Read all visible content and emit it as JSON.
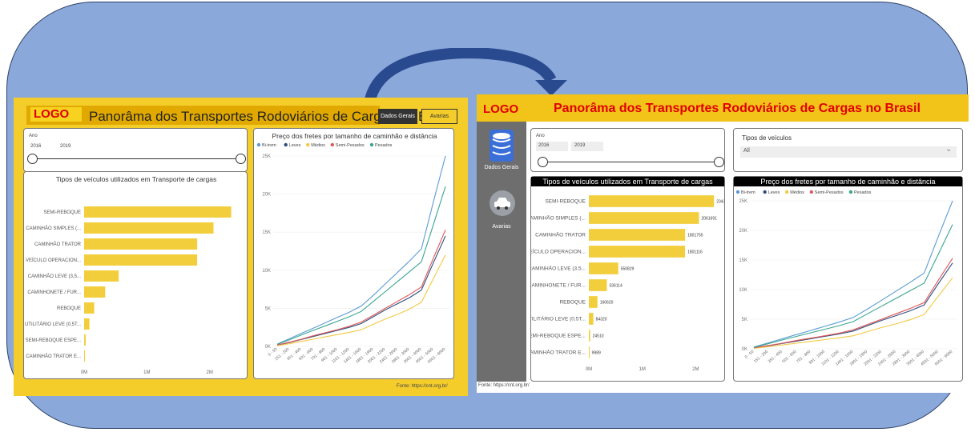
{
  "left": {
    "logo": "LOGO",
    "title": "Panorâma dos Transportes Rodoviários de Cargas no Brasil",
    "btn_dados": "Dados Gerais",
    "btn_avarias": "Avarias",
    "ano_label": "Ano",
    "ano_start": "2016",
    "ano_end": "2019",
    "bar_title": "Tipos de veículos utilizados em Transporte de cargas",
    "line_title": "Preço dos fretes por tamanho de caminhão e distância",
    "footer": "Fonte: https://cnt.org.br/"
  },
  "right": {
    "logo": "LOGO",
    "title": "Panorâma dos Transportes Rodoviários de Cargas no Brasil",
    "nav_dados": "Dados Gerais",
    "nav_avarias": "Avarias",
    "ano_label": "Ano",
    "ano_start": "2016",
    "ano_end": "2019",
    "tipos_label": "Tipos de veículos",
    "tipos_value": "All",
    "bar_title": "Tipos de veículos utilizados em Transporte de cargas",
    "line_title": "Preço dos fretes por tamanho de caminhão e distância",
    "footer": "Fonte: https://cnt.org.br/"
  },
  "chart_data": [
    {
      "type": "bar",
      "orientation": "horizontal",
      "title": "Tipos de veículos utilizados em Transporte de cargas",
      "categories": [
        "SEMI-REBOQUE",
        "CAMINHÃO SIMPLES (...",
        "CAMINHÃO TRATOR",
        "VEÍCULO OPERACION...",
        "CAMINHÃO LEVE (3,5...",
        "CAMINHONETE / FUR...",
        "REBOQUE",
        "UTILITÁRIO LEVE (0,5T...",
        "SEMI-REBOQUE ESPE...",
        "CAMINHÃO TRATOR E..."
      ],
      "values": [
        2343664,
        2061691,
        1801755,
        1801116,
        550829,
        336114,
        160620,
        84320,
        24510,
        9989
      ],
      "xticks": [
        "0M",
        "1M",
        "2M"
      ],
      "xlim": [
        0,
        3000000
      ]
    },
    {
      "type": "line",
      "title": "Preço dos fretes por tamanho de caminhão e distância",
      "categories": [
        "0 - 50",
        "151 - 200",
        "351 - 400",
        "501 - 600",
        "701 - 800",
        "901 - 1000",
        "1101 - 1200",
        "1401 - 1500",
        "1801 - 1900",
        "2001 - 2200",
        "2401 - 2600",
        "2801 - 3000",
        "3501 - 4000",
        "4501 - 5000",
        "5501 - 6000"
      ],
      "yticks": [
        "0K",
        "5K",
        "10K",
        "15K",
        "20K",
        "25K"
      ],
      "ylim": [
        0,
        25000
      ],
      "series": [
        {
          "name": "Bi-trem",
          "color": "#5b9bd5",
          "values": [
            300,
            1000,
            1700,
            2400,
            3100,
            3800,
            4500,
            5300,
            6700,
            8200,
            9700,
            11200,
            12800,
            19000,
            25000
          ]
        },
        {
          "name": "Leves",
          "color": "#2e4e7e",
          "values": [
            150,
            500,
            900,
            1300,
            1700,
            2100,
            2500,
            3000,
            3900,
            4800,
            5600,
            6400,
            7400,
            11000,
            14500
          ]
        },
        {
          "name": "Médios",
          "color": "#f4c842",
          "values": [
            100,
            350,
            650,
            950,
            1250,
            1550,
            1850,
            2200,
            2900,
            3600,
            4200,
            4900,
            5800,
            8900,
            12000
          ]
        },
        {
          "name": "Semi-Pesados",
          "color": "#e15759",
          "values": [
            180,
            550,
            950,
            1400,
            1800,
            2200,
            2650,
            3200,
            4100,
            5000,
            5900,
            6800,
            7800,
            11600,
            15300
          ]
        },
        {
          "name": "Pesados",
          "color": "#3aa58f",
          "values": [
            250,
            850,
            1500,
            2100,
            2700,
            3300,
            3900,
            4600,
            5900,
            7200,
            8500,
            9800,
            11100,
            16000,
            21000
          ]
        }
      ]
    }
  ]
}
